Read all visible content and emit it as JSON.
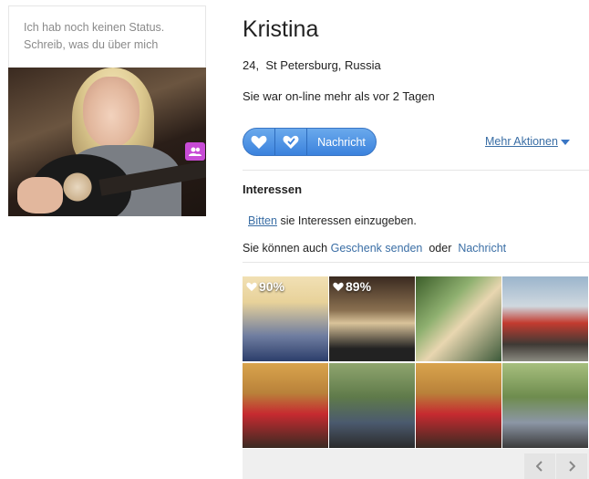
{
  "profile": {
    "status_placeholder": "Ich hab noch keinen Status. Schreib, was du über mich",
    "name": "Kristina",
    "age": "24,",
    "location": "St Petersburg, Russia",
    "online_status": "Sie war on-line mehr als vor 2 Tagen"
  },
  "actions": {
    "like_icon": "heart-icon",
    "favorite_icon": "heart-check-icon",
    "message_label": "Nachricht",
    "more_actions_label": "Mehr Aktionen"
  },
  "interests": {
    "title": "Interessen",
    "prompt_link": "Bitten",
    "prompt_rest": "sie Interessen einzugeben.",
    "gift_prefix": "Sie können auch",
    "gift_link": "Geschenk senden",
    "gift_or": "oder",
    "message_link": "Nachricht"
  },
  "gallery": {
    "photos": [
      {
        "match": "90%"
      },
      {
        "match": "89%"
      },
      {
        "match": ""
      },
      {
        "match": ""
      },
      {
        "match": ""
      },
      {
        "match": ""
      },
      {
        "match": ""
      },
      {
        "match": ""
      }
    ],
    "prev_icon": "chevron-left-icon",
    "next_icon": "chevron-right-icon"
  },
  "colors": {
    "accent_blue": "#3b82dd",
    "link_blue": "#3a6ea5",
    "friends_badge": "#c84bd6"
  }
}
